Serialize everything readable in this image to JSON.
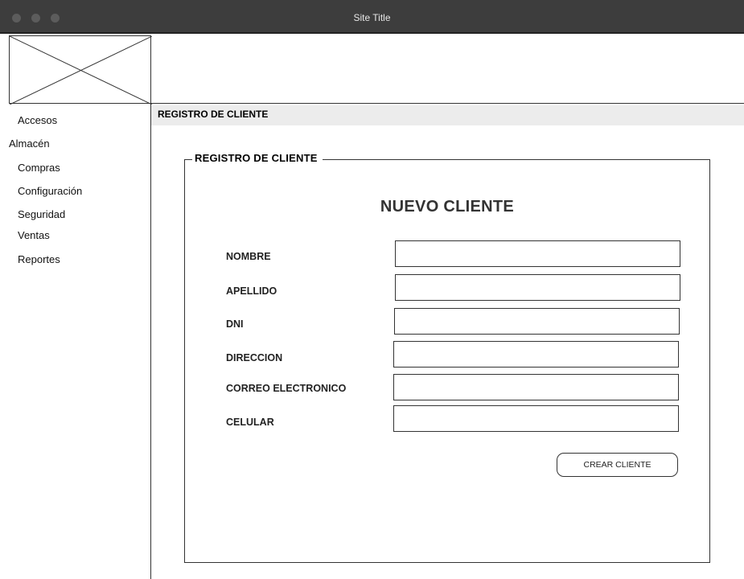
{
  "window": {
    "title": "Site Title"
  },
  "sidebar": {
    "items": [
      {
        "label": "Accesos"
      },
      {
        "label": "Almacén"
      },
      {
        "label": "Compras"
      },
      {
        "label": "Configuración"
      },
      {
        "label": "Seguridad"
      },
      {
        "label": "Ventas"
      },
      {
        "label": "Reportes"
      }
    ]
  },
  "breadcrumb": {
    "label": "REGISTRO DE CLIENTE"
  },
  "form": {
    "legend": "REGISTRO DE CLIENTE",
    "heading": "NUEVO CLIENTE",
    "fields": [
      {
        "label": "NOMBRE",
        "value": ""
      },
      {
        "label": "APELLIDO",
        "value": ""
      },
      {
        "label": "DNI",
        "value": ""
      },
      {
        "label": "DIRECCION",
        "value": ""
      },
      {
        "label": "CORREO ELECTRONICO",
        "value": ""
      },
      {
        "label": "CELULAR",
        "value": ""
      }
    ],
    "submit_label": "CREAR CLIENTE"
  },
  "icons": {
    "window_controls": [
      "close-dot",
      "minimize-dot",
      "zoom-dot"
    ],
    "logo": "image-placeholder-icon"
  }
}
